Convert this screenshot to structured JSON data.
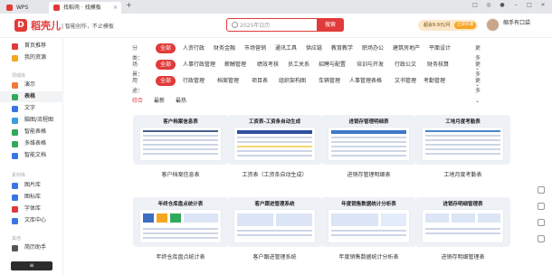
{
  "titlebar": {
    "tabs": [
      {
        "label": "WPS Office"
      },
      {
        "label": "找稻壳 · 找模板"
      }
    ],
    "new_tab": "+"
  },
  "header": {
    "logo_text": "稻壳儿",
    "slogan": "| 智能创作，不止模板",
    "search": {
      "value": "2025年日历",
      "button": "搜索"
    },
    "promo": {
      "text": "超会9.9元/月",
      "badge": "立即开通"
    },
    "user": {
      "name": "缩手有口袋",
      "sub": ""
    }
  },
  "sidebar": {
    "items": [
      {
        "label": "首页推荐",
        "color": "#e23a3a"
      },
      {
        "label": "我的资源",
        "color": "#f5a623"
      }
    ],
    "section1": "领域库",
    "types": [
      {
        "label": "演示",
        "color": "#f07a3a"
      },
      {
        "label": "表格",
        "color": "#2faa5a",
        "active": true
      },
      {
        "label": "文字",
        "color": "#3a76e2"
      },
      {
        "label": "脑图/流程图",
        "color": "#3a9ce2"
      },
      {
        "label": "智能表格",
        "color": "#2faa5a"
      },
      {
        "label": "多维表格",
        "color": "#2faa5a"
      },
      {
        "label": "智能文档",
        "color": "#3a76e2"
      }
    ],
    "section2": "素材库",
    "materials": [
      {
        "label": "图片库",
        "color": "#3a76e2"
      },
      {
        "label": "图标库",
        "color": "#3a76e2"
      },
      {
        "label": "字体库",
        "color": "#e23a3a"
      },
      {
        "label": "文库中心",
        "color": "#3a76e2"
      }
    ],
    "section3": "其他",
    "others": [
      {
        "label": "简历助手",
        "color": "#555555"
      }
    ]
  },
  "filters": [
    {
      "label": "分类：",
      "options": [
        "全部",
        "人资行政",
        "财务金融",
        "市场营销",
        "通讯工具",
        "供应链",
        "教育教学",
        "职场办公",
        "建筑房地产",
        "平面设计"
      ],
      "more": "更多 ⌄"
    },
    {
      "label": "场景：",
      "options": [
        "全部",
        "人事行政管理",
        "薪酬管理",
        "绩效考核",
        "员工关系",
        "招聘与配置",
        "培训与开发",
        "行政公文",
        "财务核算"
      ],
      "more": "更多 ⌄"
    },
    {
      "label": "用途：",
      "options": [
        "全部",
        "行政管理",
        "档案管理",
        "项目表",
        "组织架构图",
        "车辆管理",
        "人事管理表格",
        "文书管理",
        "考勤管理"
      ],
      "more": "更多 ⌄"
    }
  ],
  "sort": [
    "综合",
    "最新",
    "最热"
  ],
  "cards": [
    {
      "thumb_title": "客户档案信息表",
      "label": "客户档案信息表",
      "accent": "#4a5d8a"
    },
    {
      "thumb_title": "工资表-工资条自动生成",
      "label": "工资表（工资条自动生成）",
      "accent": "#2e4f9e"
    },
    {
      "thumb_title": "进销存管理明细表",
      "label": "进销存管理明细表",
      "accent": "#3b78c8"
    },
    {
      "thumb_title": "工地月度考勤表",
      "label": "工地月度考勤表",
      "accent": "#4a86c8"
    },
    {
      "thumb_title": "年终仓库盘点统计表",
      "label": "年终仓库盘点统计表",
      "accent": "#3b6fc0"
    },
    {
      "thumb_title": "客户跟进管理系统",
      "label": "客户跟进管理系统",
      "accent": "#e8eef8"
    },
    {
      "thumb_title": "年度销售数据统计分析表",
      "label": "年度销售数据统计分析表",
      "accent": "#e8eef8"
    },
    {
      "thumb_title": "进销存明细管理表",
      "label": "进销存明细管理表",
      "accent": "#e8eef8"
    }
  ]
}
